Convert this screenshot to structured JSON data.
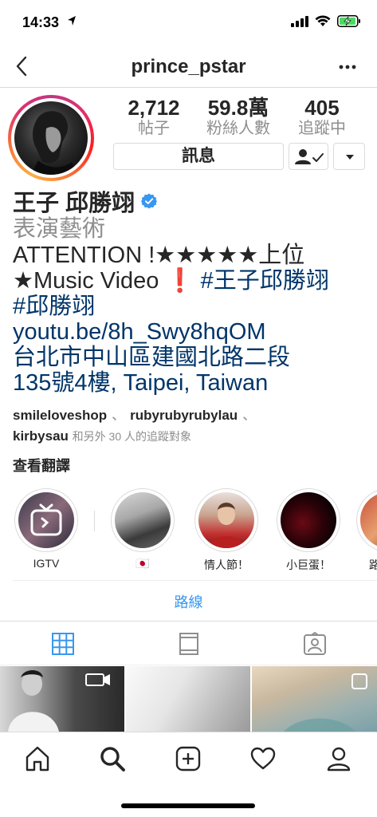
{
  "status_bar": {
    "time": "14:33"
  },
  "nav": {
    "title": "prince_pstar"
  },
  "stats": [
    {
      "count": "2,712",
      "label": "帖子"
    },
    {
      "count": "59.8萬",
      "label": "粉絲人數"
    },
    {
      "count": "405",
      "label": "追蹤中"
    }
  ],
  "buttons": {
    "message": "訊息"
  },
  "profile": {
    "name": "王子 邱勝翊",
    "category": "表演藝術",
    "bio_line1": "ATTENTION !★★★★★上位",
    "bio_line2_text": "★Music Video ",
    "bio_line2_exclaim": "❗",
    "bio_line2_tag": " #王子邱勝翊",
    "bio_line3_tag": "#邱勝翊",
    "website": "youtu.be/8h_Swy8hqOM",
    "address_line1": "台北市中山區建國北路二段",
    "address_line2": "135號4樓, Taipei, Taiwan"
  },
  "followed_by": {
    "user1": "smileloveshop",
    "user2": "rubyrubyrubylau",
    "user3": "kirbysau",
    "suffix": "和另外 30 人的追蹤對象",
    "separator": "、"
  },
  "translate_label": "查看翻譯",
  "highlights": [
    {
      "label": "IGTV"
    },
    {
      "label": "🇯🇵"
    },
    {
      "label": "情人節！"
    },
    {
      "label": "小巨蛋！"
    },
    {
      "label": "路"
    }
  ],
  "route_label": "路線",
  "colors": {
    "link": "#003569",
    "action_blue": "#3897f0",
    "muted_text": "#8e8e8e",
    "border": "#dbdbdb",
    "verified": "#3897f0"
  },
  "icons": {
    "status": [
      "location-arrow-icon",
      "signal-icon",
      "wifi-icon",
      "battery-charging-icon"
    ],
    "nav": [
      "back-chevron-icon",
      "more-dots-icon"
    ],
    "tabs": [
      "grid-icon",
      "feed-icon",
      "tagged-icon"
    ],
    "bottom_nav": [
      "home-icon",
      "search-icon",
      "add-icon",
      "heart-icon",
      "profile-icon"
    ]
  }
}
